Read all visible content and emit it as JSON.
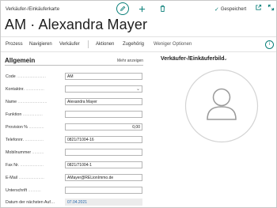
{
  "header": {
    "breadcrumb": "Verkäufer-/Einkäuferkarte",
    "saved_label": "Gespeichert",
    "title": "AM · Alexandra Mayer"
  },
  "actions": {
    "prozess": "Prozess",
    "navigieren": "Navigieren",
    "verkaeufer": "Verkäufer",
    "aktionen": "Aktionen",
    "zugehoerig": "Zugehörig",
    "weniger": "Weniger Optionen"
  },
  "general": {
    "title": "Allgemein",
    "more_label": "Mehr anzeigen",
    "fields": [
      {
        "label": "Code",
        "value": "AM"
      },
      {
        "label": "Kontaktnr.",
        "value": ""
      },
      {
        "label": "Name",
        "value": "Alexandra Mayer"
      },
      {
        "label": "Funktion",
        "value": ""
      },
      {
        "label": "Provision %",
        "value": "0,00"
      },
      {
        "label": "Telefonnr.",
        "value": "0821/71004-16"
      },
      {
        "label": "Mobilnummer",
        "value": ""
      },
      {
        "label": "Fax Nr.",
        "value": "0821/71004-1"
      },
      {
        "label": "E-Mail",
        "value": "AMayer@RELionImmo.de"
      },
      {
        "label": "Unterschrift",
        "value": ""
      },
      {
        "label": "Datum der nächsten Auf…",
        "value": "07.04.2021"
      }
    ]
  },
  "picture": {
    "title": "Verkäufer-/Einkäuferbild"
  },
  "colors": {
    "accent": "#0a7f79",
    "readonly_bg": "#ececec",
    "link": "#2a6db0"
  },
  "icons": [
    "edit-icon",
    "add-icon",
    "delete-icon",
    "checkmark-icon",
    "open-new-window-icon",
    "expand-icon",
    "info-icon",
    "chevron-down-icon",
    "person-placeholder-icon"
  ]
}
